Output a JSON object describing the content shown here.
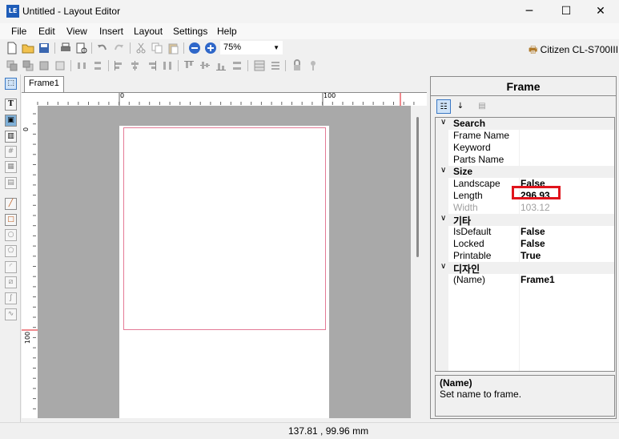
{
  "window": {
    "title": "Untitled - Layout Editor",
    "app_icon_text": "LE",
    "minimize_glyph": "─",
    "maximize_glyph": "☐",
    "close_glyph": "✕"
  },
  "menu": {
    "items": [
      "File",
      "Edit",
      "View",
      "Insert",
      "Layout",
      "Settings",
      "Help"
    ]
  },
  "toolbar": {
    "zoom": "75%",
    "printer": "Citizen CL-S700III"
  },
  "editor": {
    "tab_label": "Frame1",
    "ruler_top_0": "0",
    "ruler_top_100": "100",
    "ruler_left_0": "0",
    "ruler_left_100": "100"
  },
  "status": {
    "coords": "137.81 , 99.96 mm"
  },
  "panel": {
    "title": "Frame",
    "categories": [
      {
        "name": "Search",
        "props": [
          {
            "name": "Frame Name",
            "value": ""
          },
          {
            "name": "Keyword",
            "value": ""
          },
          {
            "name": "Parts Name",
            "value": ""
          }
        ]
      },
      {
        "name": "Size",
        "props": [
          {
            "name": "Landscape",
            "value": "False"
          },
          {
            "name": "Length",
            "value": "296.93"
          },
          {
            "name": "Width",
            "value": "103.12"
          }
        ]
      },
      {
        "name": "기타",
        "props": [
          {
            "name": "IsDefault",
            "value": "False"
          },
          {
            "name": "Locked",
            "value": "False"
          },
          {
            "name": "Printable",
            "value": "True"
          }
        ]
      },
      {
        "name": "디자인",
        "props": [
          {
            "name": "(Name)",
            "value": "Frame1"
          }
        ]
      }
    ],
    "description_title": "(Name)",
    "description_text": "Set name to frame."
  },
  "colors": {
    "frame_border": "#e47a96",
    "highlight": "#e0141c",
    "canvas_bg": "#a9a9a9"
  }
}
